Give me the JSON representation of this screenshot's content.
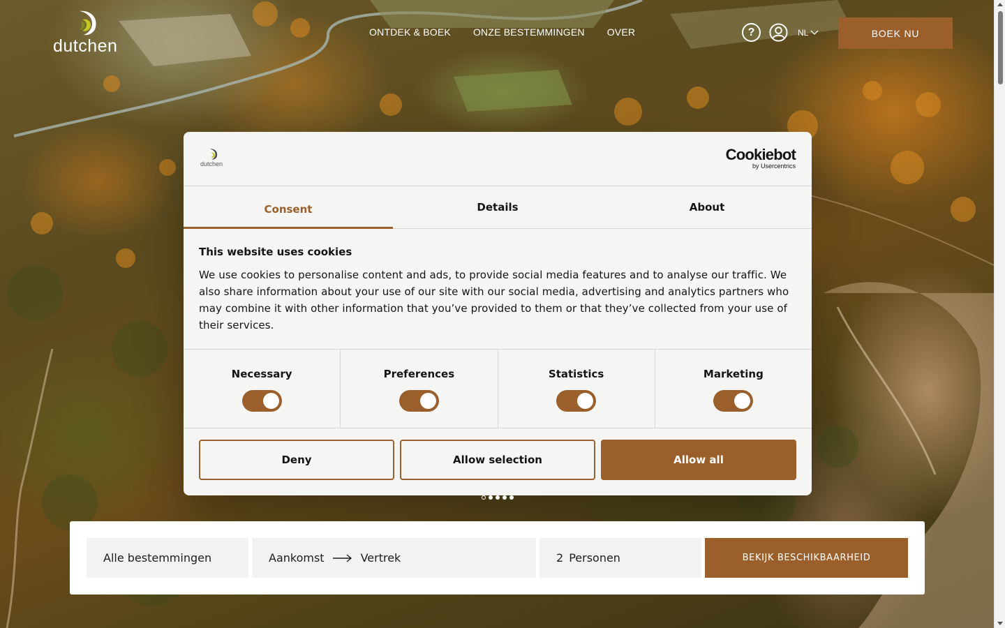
{
  "header": {
    "logo_text": "dutchen",
    "nav": [
      "ONTDEK & BOEK",
      "ONZE BESTEMMINGEN",
      "OVER"
    ],
    "help_symbol": "?",
    "language": "NL",
    "cta": "BOEK NU",
    "icons": [
      "help-icon",
      "user-icon",
      "chevron-down-icon"
    ]
  },
  "cookie_dialog": {
    "brand_logo_text": "dutchen",
    "cookiebot_title": "Cookiebot",
    "cookiebot_sub": "by Usercentrics",
    "tabs": [
      "Consent",
      "Details",
      "About"
    ],
    "active_tab": "Consent",
    "title": "This website uses cookies",
    "text": "We use cookies to personalise content and ads, to provide social media features and to analyse our traffic. We also share information about your use of our site with our social media, advertising and analytics partners who may combine it with other information that you’ve provided to them or that they’ve collected from your use of their services.",
    "toggles": [
      {
        "label": "Necessary",
        "on": true
      },
      {
        "label": "Preferences",
        "on": true
      },
      {
        "label": "Statistics",
        "on": true
      },
      {
        "label": "Marketing",
        "on": true
      }
    ],
    "buttons": {
      "deny": "Deny",
      "allow_selection": "Allow selection",
      "allow_all": "Allow all"
    }
  },
  "carousel": {
    "count": 5,
    "active": 1
  },
  "search": {
    "destination": "Alle bestemmingen",
    "arrival": "Aankomst",
    "departure": "Vertrek",
    "guests_count": "2",
    "guests_label": "Personen",
    "submit": "BEKIJK BESCHIKBAARHEID"
  },
  "colors": {
    "accent": "#9a5f2b",
    "dialog_bg": "#f5f5f3",
    "text": "#141414"
  }
}
